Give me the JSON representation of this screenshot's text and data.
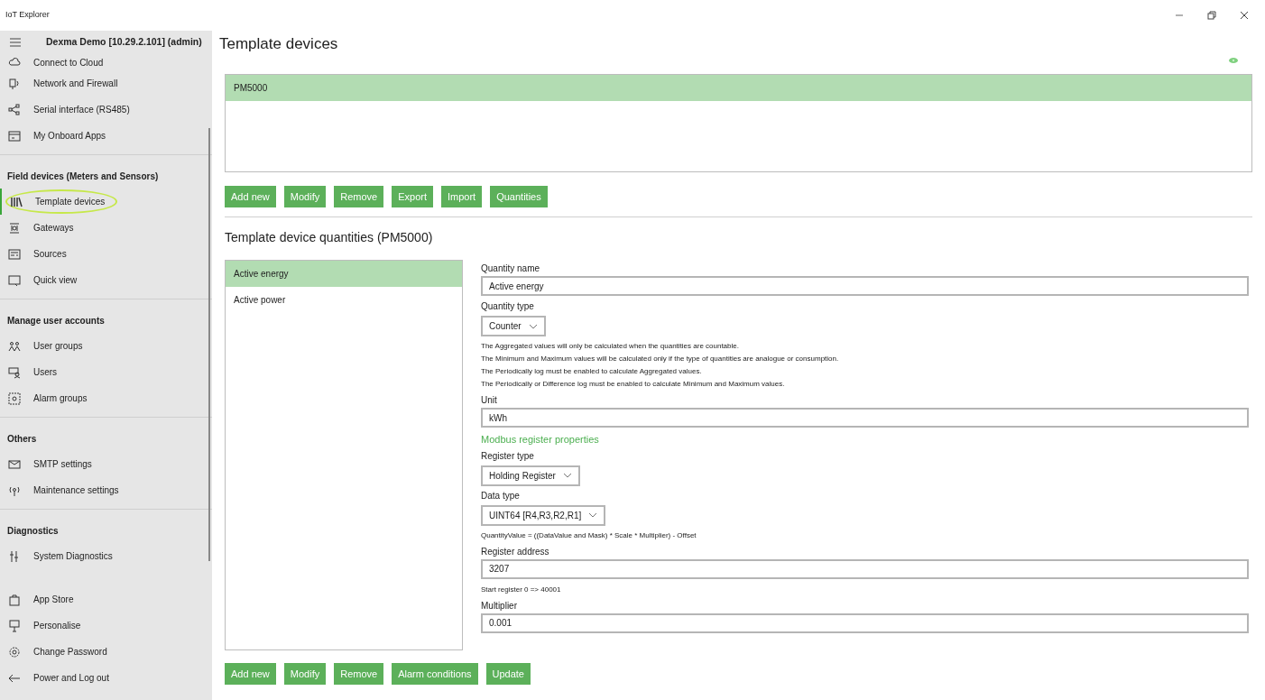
{
  "window": {
    "title": "IoT Explorer"
  },
  "sidebar": {
    "header": "Dexma Demo [10.29.2.101] (admin)",
    "sections": [
      {
        "items": [
          {
            "label": "Connect to Cloud",
            "selected": false
          },
          {
            "label": "Network and Firewall",
            "selected": false
          },
          {
            "label": "Serial interface (RS485)",
            "selected": false
          },
          {
            "label": "My Onboard Apps",
            "selected": false
          }
        ]
      },
      {
        "title": "Field devices (Meters and Sensors)",
        "items": [
          {
            "label": "Template devices",
            "selected": true
          },
          {
            "label": "Gateways",
            "selected": false
          },
          {
            "label": "Sources",
            "selected": false
          },
          {
            "label": "Quick view",
            "selected": false
          }
        ]
      },
      {
        "title": "Manage user accounts",
        "items": [
          {
            "label": "User groups",
            "selected": false
          },
          {
            "label": "Users",
            "selected": false
          },
          {
            "label": "Alarm groups",
            "selected": false
          }
        ]
      },
      {
        "title": "Others",
        "items": [
          {
            "label": "SMTP settings",
            "selected": false
          },
          {
            "label": "Maintenance settings",
            "selected": false
          }
        ]
      },
      {
        "title": "Diagnostics",
        "items": [
          {
            "label": "System Diagnostics",
            "selected": false
          }
        ]
      }
    ],
    "footer": [
      "App Store",
      "Personalise",
      "Change Password",
      "Power and Log out"
    ]
  },
  "page": {
    "title": "Template devices",
    "devices": [
      {
        "label": "PM5000",
        "selected": true
      }
    ],
    "device_buttons": [
      "Add new",
      "Modify",
      "Remove",
      "Export",
      "Import",
      "Quantities"
    ],
    "quantities_title": "Template device quantities (PM5000)",
    "quantities": [
      {
        "label": "Active energy",
        "selected": true
      },
      {
        "label": "Active power",
        "selected": false
      }
    ],
    "form": [
      {
        "kind": "text",
        "label": "Quantity name",
        "value": "Active energy"
      },
      {
        "kind": "select",
        "label": "Quantity type",
        "value": "Counter"
      },
      {
        "kind": "note",
        "lines": [
          "The Aggregated values will only be calculated when the quantities are countable.",
          "The Minimum and Maximum values will be calculated only if the type of quantities are analogue or consumption.",
          "The Periodically log must be enabled to calculate Aggregated values.",
          "The Periodically or Difference log must be enabled to calculate Minimum and Maximum values."
        ]
      },
      {
        "kind": "text",
        "label": "Unit",
        "value": "kWh"
      },
      {
        "kind": "heading",
        "label": "Modbus register properties"
      },
      {
        "kind": "select",
        "label": "Register type",
        "value": "Holding Register"
      },
      {
        "kind": "select",
        "label": "Data type",
        "value": "UINT64 [R4,R3,R2,R1]"
      },
      {
        "kind": "note",
        "lines": [
          "QuantityValue = ((DataValue and Mask) * Scale * Multiplier) - Offset"
        ]
      },
      {
        "kind": "text",
        "label": "Register address",
        "value": "3207"
      },
      {
        "kind": "note",
        "lines": [
          "Start register 0 => 40001"
        ]
      },
      {
        "kind": "text",
        "label": "Multiplier",
        "value": "0.001"
      }
    ],
    "quantity_buttons": [
      "Add new",
      "Modify",
      "Remove",
      "Alarm conditions",
      "Update"
    ]
  }
}
